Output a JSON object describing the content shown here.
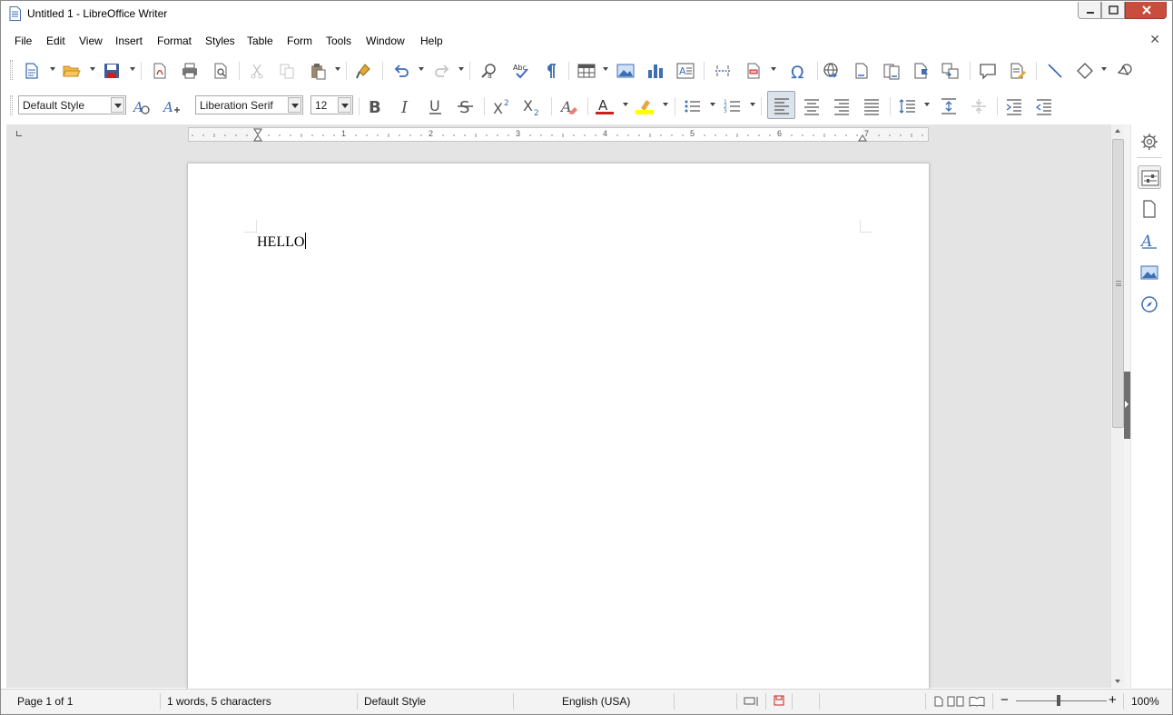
{
  "window": {
    "title": "Untitled 1 - LibreOffice Writer",
    "app_icon": "writer-document-icon"
  },
  "menu": {
    "items": [
      "File",
      "Edit",
      "View",
      "Insert",
      "Format",
      "Styles",
      "Table",
      "Form",
      "Tools",
      "Window",
      "Help"
    ]
  },
  "toolbar_standard": {
    "icons": [
      "new-document-icon",
      "open-folder-icon",
      "save-icon",
      "export-pdf-icon",
      "print-icon",
      "print-preview-icon",
      "cut-icon",
      "copy-icon",
      "paste-icon",
      "clone-formatting-icon",
      "undo-icon",
      "redo-icon",
      "find-replace-icon",
      "spelling-icon",
      "formatting-marks-icon",
      "insert-table-icon",
      "insert-image-icon",
      "insert-chart-icon",
      "insert-textbox-icon",
      "page-break-icon",
      "insert-field-icon",
      "special-character-icon",
      "hyperlink-icon",
      "footnote-icon",
      "endnote-icon",
      "bookmark-icon",
      "cross-reference-icon",
      "comment-icon",
      "track-changes-icon",
      "line-icon",
      "basic-shapes-icon",
      "draw-functions-icon"
    ]
  },
  "toolbar_formatting": {
    "paragraph_style": "Default Style",
    "font_name": "Liberation Serif",
    "font_size": "12",
    "icons": [
      "update-style-icon",
      "new-style-icon",
      "bold-icon",
      "italic-icon",
      "underline-icon",
      "strikethrough-icon",
      "superscript-icon",
      "subscript-icon",
      "clear-formatting-icon",
      "font-color-icon",
      "highlight-icon",
      "bullets-icon",
      "numbering-icon",
      "align-left-icon",
      "align-center-icon",
      "align-right-icon",
      "justify-icon",
      "line-spacing-icon",
      "increase-paragraph-spacing-icon",
      "decrease-paragraph-spacing-icon",
      "increase-indent-icon",
      "decrease-indent-icon"
    ],
    "colors": {
      "font_color": "#c9211e",
      "highlight_color": "#ffff00",
      "accent_blue": "#3c6eb4"
    }
  },
  "ruler": {
    "numbers": [
      "1",
      "2",
      "3",
      "4",
      "5",
      "6",
      "7"
    ]
  },
  "document": {
    "text": "HELLO"
  },
  "sidebar": {
    "icons": [
      "properties-gear-icon",
      "properties-icon",
      "page-icon",
      "styles-icon",
      "gallery-icon",
      "navigator-icon"
    ]
  },
  "statusbar": {
    "page": "Page 1 of 1",
    "word_count": "1 words, 5 characters",
    "page_style": "Default Style",
    "language": "English (USA)",
    "zoom": "100%"
  }
}
